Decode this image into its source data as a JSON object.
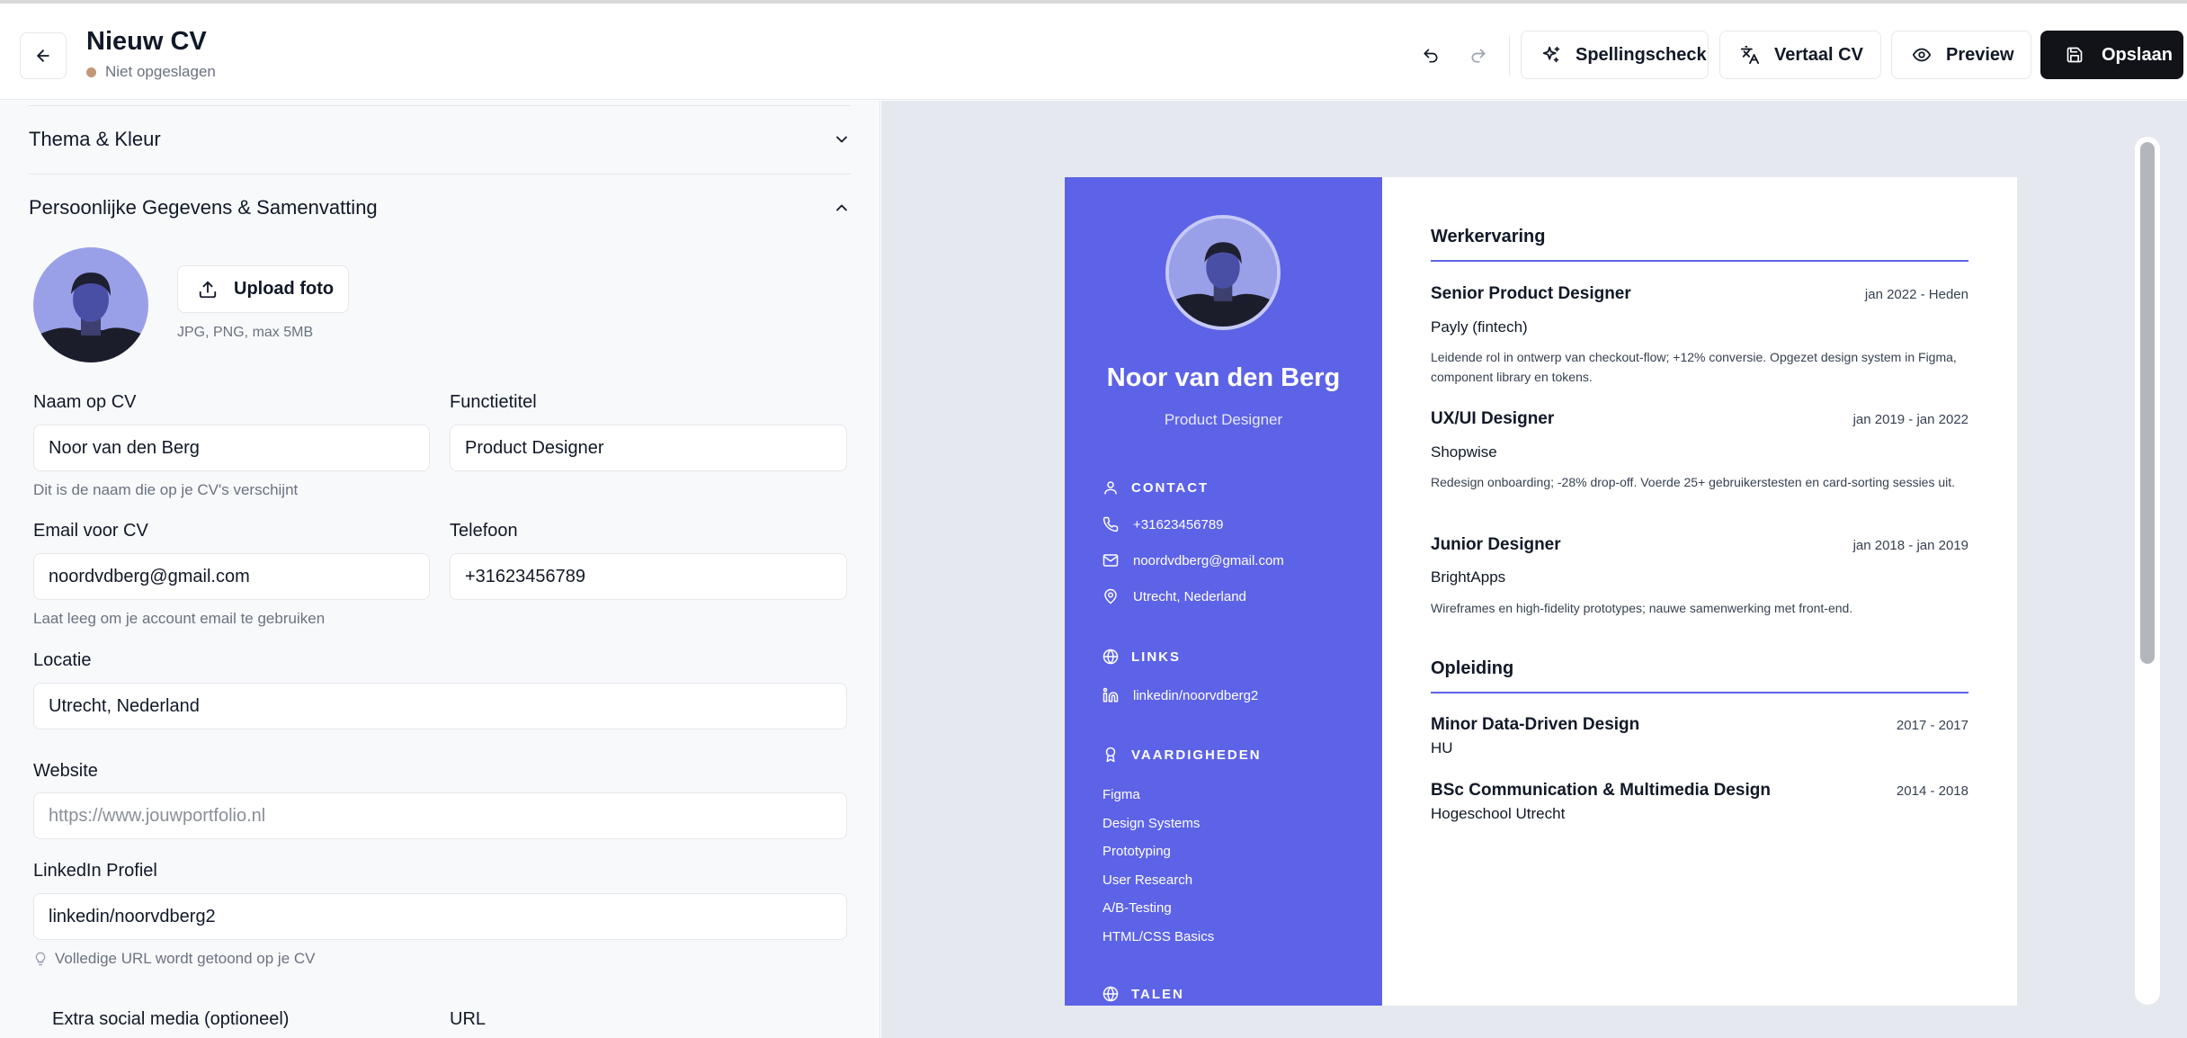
{
  "header": {
    "title": "Nieuw CV",
    "status": "Niet opgeslagen",
    "buttons": {
      "spellcheck": "Spellingscheck",
      "translate": "Vertaal CV",
      "preview": "Preview",
      "save": "Opslaan"
    }
  },
  "editor": {
    "sections": {
      "theme": "Thema & Kleur",
      "personal": "Persoonlijke Gegevens & Samenvatting"
    },
    "photo": {
      "upload_label": "Upload foto",
      "hint": "JPG, PNG, max 5MB"
    },
    "fields": {
      "name": {
        "label": "Naam op CV",
        "value": "Noor van den Berg",
        "helper": "Dit is de naam die op je CV's verschijnt"
      },
      "job_title": {
        "label": "Functietitel",
        "value": "Product Designer"
      },
      "email": {
        "label": "Email voor CV",
        "value": "noordvdberg@gmail.com",
        "helper": "Laat leeg om je account email te gebruiken"
      },
      "phone": {
        "label": "Telefoon",
        "value": "+31623456789"
      },
      "location": {
        "label": "Locatie",
        "value": "Utrecht, Nederland"
      },
      "website": {
        "label": "Website",
        "placeholder": "https://www.jouwportfolio.nl"
      },
      "linkedin": {
        "label": "LinkedIn Profiel",
        "value": "linkedin/noorvdberg2",
        "helper": "Volledige URL wordt getoond op je CV"
      },
      "extra_social": {
        "label": "Extra social media (optioneel)",
        "url_label": "URL"
      }
    }
  },
  "cv": {
    "name": "Noor van den Berg",
    "role": "Product Designer",
    "contact": {
      "heading": "CONTACT",
      "phone": "+31623456789",
      "email": "noordvdberg@gmail.com",
      "location": "Utrecht, Nederland"
    },
    "links": {
      "heading": "LINKS",
      "linkedin": "linkedin/noorvdberg2"
    },
    "skills": {
      "heading": "VAARDIGHEDEN",
      "items": [
        "Figma",
        "Design Systems",
        "Prototyping",
        "User Research",
        "A/B-Testing",
        "HTML/CSS Basics"
      ]
    },
    "languages": {
      "heading": "TALEN"
    },
    "experience": {
      "heading": "Werkervaring",
      "items": [
        {
          "title": "Senior Product Designer",
          "date": "jan 2022 - Heden",
          "company": "Payly (fintech)",
          "description": "Leidende rol in ontwerp van checkout-flow; +12% conversie. Opgezet design system in Figma, component library en tokens."
        },
        {
          "title": "UX/UI Designer",
          "date": "jan 2019 - jan 2022",
          "company": "Shopwise",
          "description": "Redesign onboarding; -28% drop-off. Voerde 25+ gebruikerstesten en card-sorting sessies uit."
        },
        {
          "title": "Junior Designer",
          "date": "jan 2018 - jan 2019",
          "company": "BrightApps",
          "description": "Wireframes en high-fidelity prototypes; nauwe samenwerking met front-end."
        }
      ]
    },
    "education": {
      "heading": "Opleiding",
      "items": [
        {
          "title": "Minor Data-Driven Design",
          "date": "2017 - 2017",
          "school": "HU"
        },
        {
          "title": "BSc Communication & Multimedia Design",
          "date": "2014 - 2018",
          "school": "Hogeschool Utrecht"
        }
      ]
    }
  }
}
